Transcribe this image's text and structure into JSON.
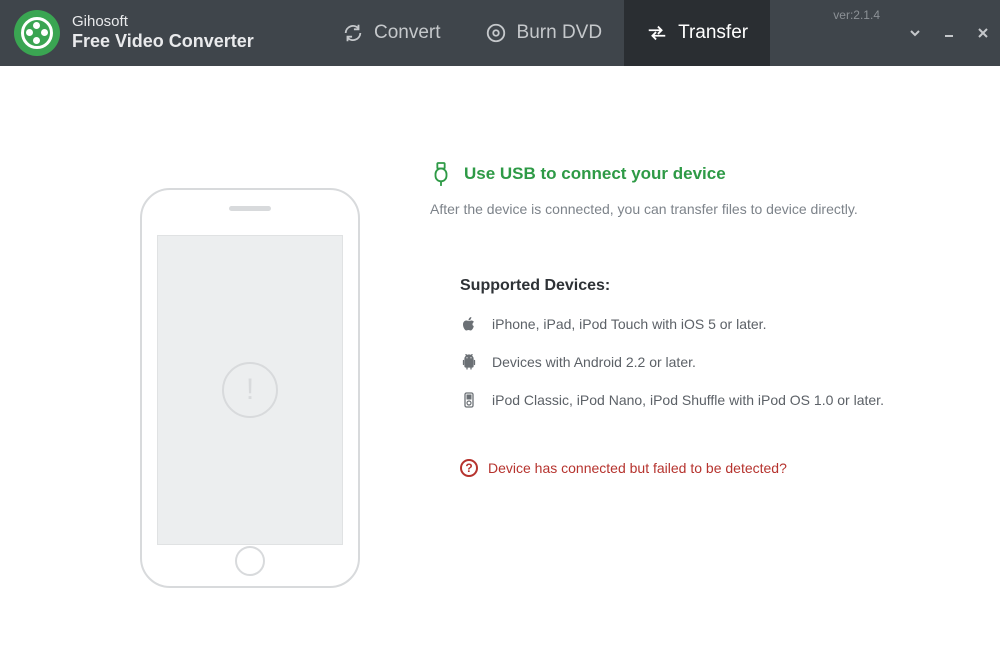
{
  "brand": {
    "name": "Gihosoft",
    "product": "Free Video Converter"
  },
  "tabs": {
    "convert": "Convert",
    "burn": "Burn DVD",
    "transfer": "Transfer"
  },
  "version": "ver:2.1.4",
  "transfer": {
    "connect_title": "Use USB to connect your device",
    "connect_sub": "After the device is connected, you can transfer files to device directly.",
    "supported_heading": "Supported Devices:",
    "devices": {
      "apple": "iPhone, iPad, iPod Touch with iOS 5 or later.",
      "android": "Devices with Android 2.2 or later.",
      "ipod": "iPod Classic, iPod Nano, iPod Shuffle with iPod OS 1.0 or later."
    },
    "error_link": "Device has connected but failed to be detected?"
  }
}
